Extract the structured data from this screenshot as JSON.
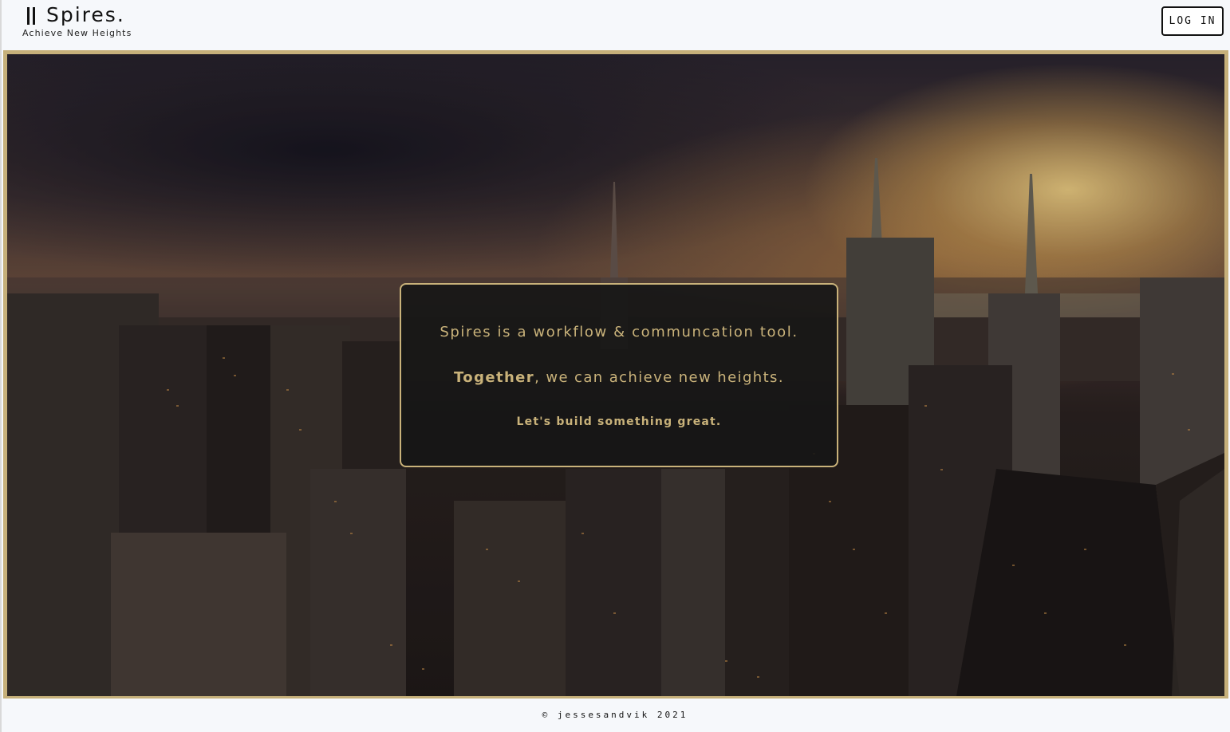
{
  "header": {
    "brand_title": "Spires.",
    "brand_tagline": "Achieve New Heights",
    "login_label": "LOG IN"
  },
  "hero": {
    "image_icon": "city-skyline-photo",
    "card": {
      "line1": "Spires is a workflow & communcation tool.",
      "line2_strong": "Together",
      "line2_rest": ", we can achieve new heights.",
      "line3": "Let's build something great."
    }
  },
  "footer": {
    "text": "© jessesandvik 2021"
  },
  "colors": {
    "accent_gold": "#c9b27a",
    "background": "#f6f8fb",
    "text_dark": "#111111"
  }
}
